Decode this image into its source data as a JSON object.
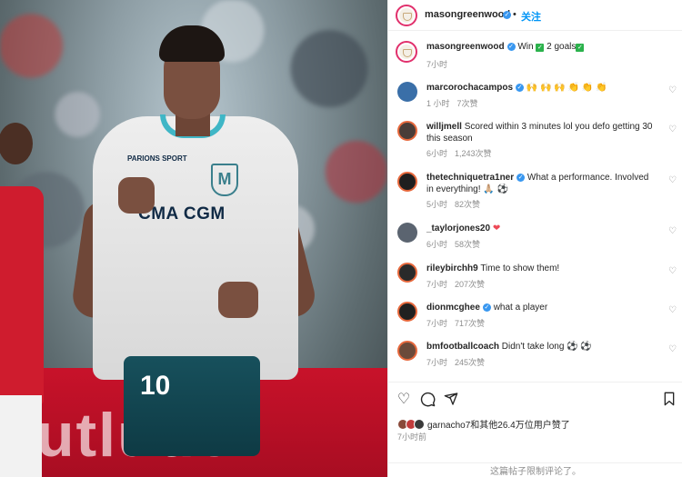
{
  "photo": {
    "ad_text": "utlude",
    "sponsor": "CMA CGM",
    "partner_badge": "PARIONS SPORT",
    "crest_letter": "M",
    "shirt_number": "10"
  },
  "post": {
    "author": "masongreenwood",
    "separator": "•",
    "follow_label": "关注",
    "caption_text": "Win",
    "caption_goals": "2 goals",
    "caption_time": "7小时"
  },
  "comments": [
    {
      "user": "marcorochacampos",
      "verified": true,
      "text": "🙌 🙌 🙌 👏 👏 👏",
      "time": "1 小时",
      "likes": "7次赞",
      "avatar_color": "#3a6fa8"
    },
    {
      "user": "willjmell",
      "verified": false,
      "text": "Scored within 3 minutes lol you defo getting 30 this season",
      "time": "6小时",
      "likes": "1,243次赞",
      "avatar_color": "#4a3d38"
    },
    {
      "user": "thetechniquetra1ner",
      "verified": true,
      "text": "What a performance. Involved in everything! 🙏🏼 ⚽",
      "time": "5小时",
      "likes": "82次赞",
      "avatar_color": "#1f1f1f"
    },
    {
      "user": "_taylorjones20",
      "verified": false,
      "text": "❤",
      "time": "6小时",
      "likes": "58次赞",
      "avatar_color": "#5b6470"
    },
    {
      "user": "rileybirchh9",
      "verified": false,
      "text": "Time to show them!",
      "time": "7小时",
      "likes": "207次赞",
      "avatar_color": "#2a2a2a"
    },
    {
      "user": "dionmcghee",
      "verified": true,
      "text": "what a player",
      "time": "7小时",
      "likes": "717次赞",
      "avatar_color": "#202020"
    },
    {
      "user": "bmfootballcoach",
      "verified": false,
      "text": "Didn't take long ⚽ ⚽",
      "time": "7小时",
      "likes": "245次赞",
      "avatar_color": "#6b4a3a"
    }
  ],
  "actions": {
    "like_icon": "heart-outline-icon",
    "comment_icon": "comment-bubble-icon",
    "share_icon": "paper-plane-icon",
    "save_icon": "bookmark-icon"
  },
  "likes": {
    "text": "garnacho7和其他26.4万位用户赞了",
    "time": "7小时前"
  },
  "comments_disabled": "这篇帖子限制评论了。",
  "colors": {
    "link_blue": "#0095f6",
    "verified_blue": "#3897f0",
    "muted_gray": "#8e8e8e",
    "jersey_teal": "#3fb6c6"
  }
}
